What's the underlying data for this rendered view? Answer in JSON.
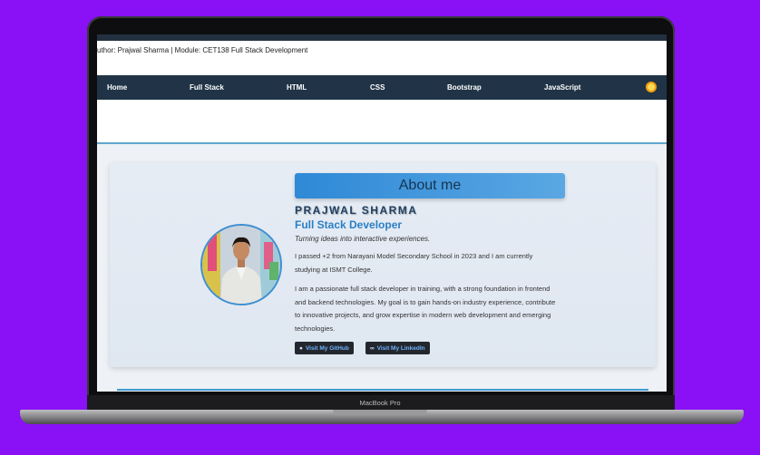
{
  "header": {
    "author_line": "uthor: Prajwal Sharma | Module: CET138 Full Stack Development"
  },
  "nav": {
    "items": [
      "Home",
      "Full Stack",
      "HTML",
      "CSS",
      "Bootstrap",
      "JavaScript"
    ],
    "theme_icon": "sun-icon"
  },
  "about": {
    "title": "About me",
    "name": "PRAJWAL SHARMA",
    "role": "Full Stack Developer",
    "tagline": "Turning ideas into interactive experiences.",
    "para1": "I passed +2 from Narayani Model Secondary School in 2023 and I am currently studying at ISMT College.",
    "para2": "I am a passionate full stack developer in training, with a strong foundation in frontend and backend technologies. My goal is to gain hands-on industry experience, contribute to innovative projects, and grow expertise in modern web development and emerging technologies.",
    "github_label": "Visit My GitHub",
    "linkedin_label": "Visit My LinkedIn"
  },
  "device": {
    "label": "MacBook Pro"
  },
  "colors": {
    "background": "#8a10f5",
    "nav": "#213447",
    "accent": "#2f89d6",
    "link": "#6fb2ff"
  }
}
